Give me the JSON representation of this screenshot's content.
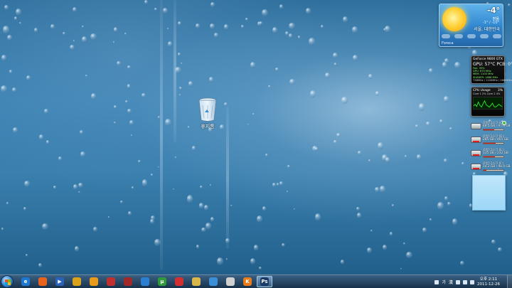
{
  "desktop": {
    "recycle_bin_label": "휴지통"
  },
  "weather": {
    "temperature": "-4°",
    "condition": "맑음",
    "range": "-1° / -10°",
    "location": "서울, 대한민국",
    "source": "Foreca"
  },
  "gpu_meter": {
    "title": "GeForce 9800 GTX",
    "temp_line": "GPU: 57°C   PCB: 0°C",
    "rows": [
      "Fan: 35%",
      "GPU: 675 MHz",
      "MEM: 1100 MHz",
      "SHADER: 1688 MHz"
    ],
    "footer": "738MHz / 1100MHz / 1688MHz"
  },
  "cpu_meter": {
    "title": "CPU Usage",
    "value": "3%",
    "sub": "Core 1  2%  Core 2  4%",
    "history": [
      5,
      8,
      4,
      12,
      6,
      3,
      9,
      14,
      7,
      5,
      3,
      6,
      10,
      4,
      3,
      5,
      8,
      6,
      4,
      3
    ]
  },
  "drives": [
    {
      "name": "로컬 디스크 (C:)",
      "detail": "48.5 GB / 97.6 GB",
      "used": 0.52,
      "warn": false
    },
    {
      "name": "로컬 디스크 (D:)",
      "detail": "285 GB / 465 GB",
      "used": 0.62,
      "warn": true
    },
    {
      "name": "로컬 디스크 (E:)",
      "detail": "135 GB / 232 GB",
      "used": 0.58,
      "warn": true
    },
    {
      "name": "로컬 디스크 (F:)",
      "detail": "14.2 GB / 98.4 GB",
      "used": 0.14,
      "warn": true
    }
  ],
  "taskbar": {
    "apps": [
      {
        "name": "ie",
        "icon": "e",
        "color": "#1e78d2",
        "active": false
      },
      {
        "name": "firefox",
        "icon": "",
        "color": "#e8631c",
        "active": false
      },
      {
        "name": "media-player",
        "icon": "▶",
        "color": "#2a62b8",
        "active": false
      },
      {
        "name": "paint",
        "icon": "",
        "color": "#d9a21a",
        "active": false
      },
      {
        "name": "tool",
        "icon": "",
        "color": "#e89a1a",
        "active": false
      },
      {
        "name": "torrent-client",
        "icon": "",
        "color": "#c03030",
        "active": false
      },
      {
        "name": "gift",
        "icon": "",
        "color": "#a02828",
        "active": false
      },
      {
        "name": "globe",
        "icon": "",
        "color": "#2a7fd2",
        "active": false
      },
      {
        "name": "utorrent",
        "icon": "µ",
        "color": "#2f9a38",
        "active": false
      },
      {
        "name": "arc",
        "icon": "",
        "color": "#d23030",
        "active": false
      },
      {
        "name": "folder",
        "icon": "",
        "color": "#d8b64a",
        "active": false
      },
      {
        "name": "pin",
        "icon": "",
        "color": "#3b8ed8",
        "active": false
      },
      {
        "name": "circle-app",
        "icon": "",
        "color": "#d0d0d0",
        "active": false
      },
      {
        "name": "k-app",
        "icon": "K",
        "color": "#e87a1a",
        "active": false
      },
      {
        "name": "photoshop",
        "icon": "Ps",
        "color": "#1c3a66",
        "active": true
      }
    ],
    "language": "가",
    "language_mode": "漢",
    "time": "오후 2:11",
    "date": "2011-12-26"
  }
}
